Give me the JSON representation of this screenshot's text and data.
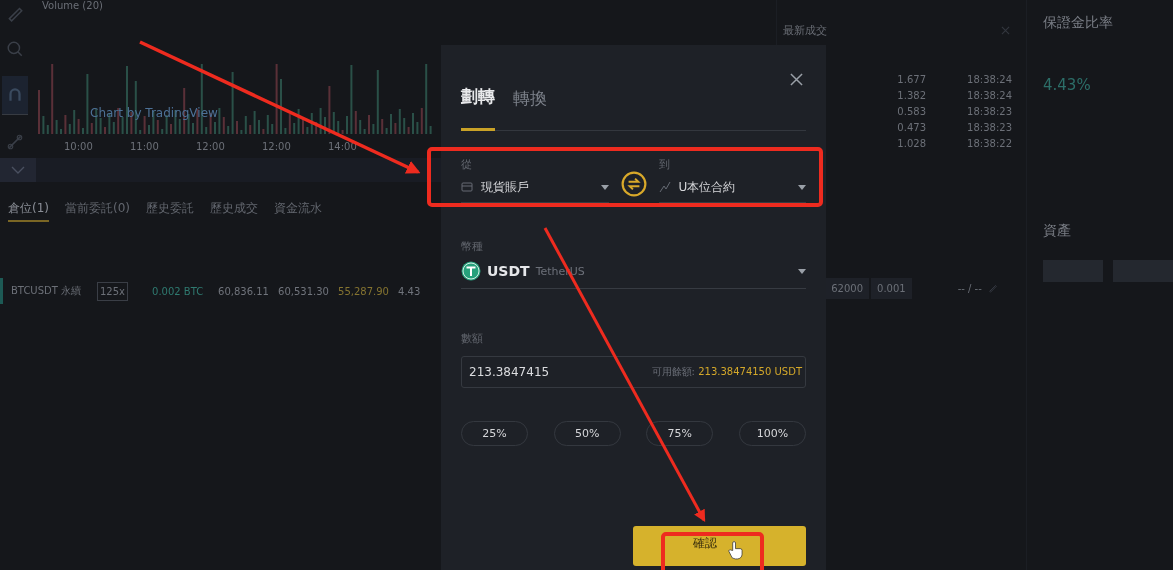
{
  "chart": {
    "legend": "Volume (20)",
    "watermark": "Chart by TradingView",
    "time_ticks": [
      "10:00",
      "11:00",
      "12:00",
      "12:00",
      "14:00"
    ]
  },
  "bottom_tabs": [
    {
      "label": "倉位(1)",
      "selected": true
    },
    {
      "label": "當前委託(0)",
      "selected": false
    },
    {
      "label": "歷史委託",
      "selected": false
    },
    {
      "label": "歷史成交",
      "selected": false
    },
    {
      "label": "資金流水",
      "selected": false
    }
  ],
  "position": {
    "symbol": "BTCUSDT 永續",
    "leverage": "125x",
    "size": "0.002 BTC",
    "entry_price": "60,836.11",
    "mark_price": "60,531.30",
    "liquidation_price": "55,287.90",
    "column_5": "4.43"
  },
  "trades": {
    "title": "最新成交",
    "rows": [
      {
        "amount": "1.677",
        "time": "18:38:24"
      },
      {
        "amount": "1.382",
        "time": "18:38:24"
      },
      {
        "amount": "0.583",
        "time": "18:38:23"
      },
      {
        "amount": "0.473",
        "time": "18:38:23"
      },
      {
        "amount": "1.028",
        "time": "18:38:22"
      }
    ]
  },
  "order_row": {
    "price": "62000",
    "quantity": "0.001",
    "tp_sl": "-- / --"
  },
  "margin": {
    "title": "保證金比率",
    "ratio": "4.43%"
  },
  "assets": {
    "title": "資產"
  },
  "modal": {
    "tabs": [
      {
        "label": "劃轉",
        "selected": true
      },
      {
        "label": "轉換",
        "selected": false
      }
    ],
    "from": {
      "label": "從",
      "value": "現貨賬戶"
    },
    "to": {
      "label": "到",
      "value": "U本位合約"
    },
    "coin": {
      "label": "幣種",
      "symbol": "USDT",
      "name": "TetherUS"
    },
    "amount": {
      "label": "數額",
      "value": "213.3847415",
      "available_label": "可用餘額:",
      "available": "213.38474150 USDT"
    },
    "percents": [
      "25%",
      "50%",
      "75%",
      "100%"
    ],
    "confirm": "確認"
  }
}
